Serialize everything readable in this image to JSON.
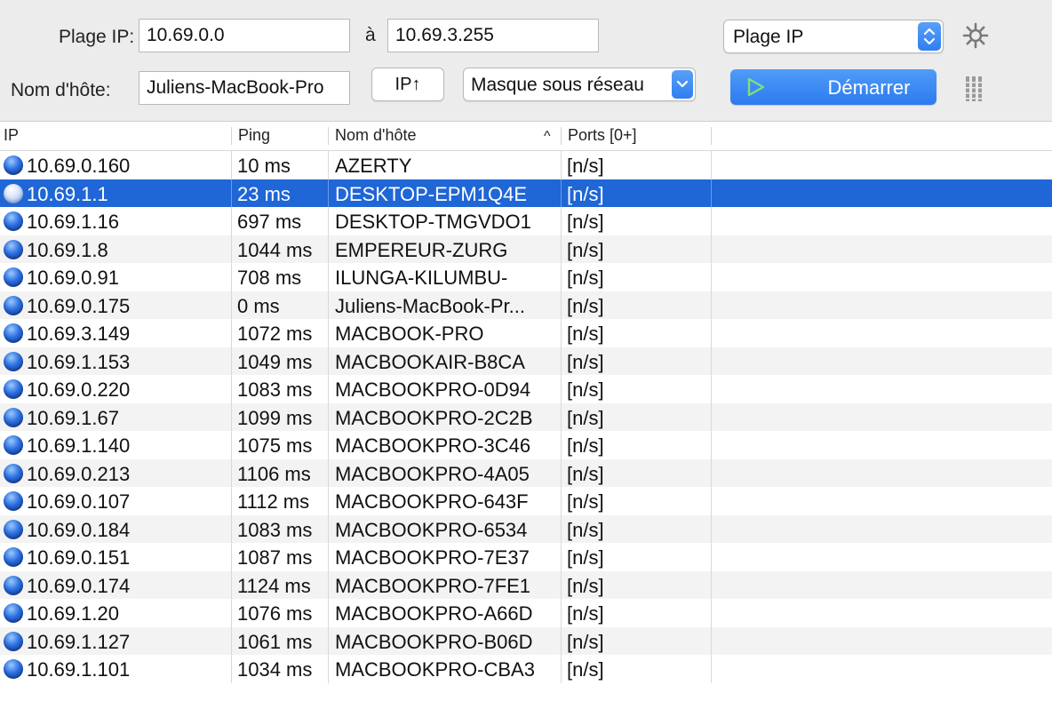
{
  "toolbar": {
    "range_label": "Plage IP:",
    "range_start": "10.69.0.0",
    "range_to": "à",
    "range_end": "10.69.3.255",
    "feeder_select": "Plage IP",
    "hostname_label": "Nom d'hôte:",
    "hostname_value": "Juliens-MacBook-Pro",
    "ip_up_button": "IP↑",
    "netmask_select": "Masque sous réseau",
    "start_button": "Démarrer"
  },
  "table": {
    "columns": [
      "IP",
      "Ping",
      "Nom d'hôte",
      "Ports [0+]"
    ],
    "sort_indicator": "^",
    "rows": [
      {
        "ip": "10.69.0.160",
        "ping": "10 ms",
        "host": "AZERTY",
        "ports": "[n/s]"
      },
      {
        "ip": "10.69.1.1",
        "ping": "23 ms",
        "host": "DESKTOP-EPM1Q4E",
        "ports": "[n/s]"
      },
      {
        "ip": "10.69.1.16",
        "ping": "697 ms",
        "host": "DESKTOP-TMGVDO1",
        "ports": "[n/s]"
      },
      {
        "ip": "10.69.1.8",
        "ping": "1044 ms",
        "host": "EMPEREUR-ZURG",
        "ports": "[n/s]"
      },
      {
        "ip": "10.69.0.91",
        "ping": "708 ms",
        "host": "ILUNGA-KILUMBU-",
        "ports": "[n/s]"
      },
      {
        "ip": "10.69.0.175",
        "ping": "0 ms",
        "host": "Juliens-MacBook-Pr...",
        "ports": "[n/s]"
      },
      {
        "ip": "10.69.3.149",
        "ping": "1072 ms",
        "host": "MACBOOK-PRO",
        "ports": "[n/s]"
      },
      {
        "ip": "10.69.1.153",
        "ping": "1049 ms",
        "host": "MACBOOKAIR-B8CA",
        "ports": "[n/s]"
      },
      {
        "ip": "10.69.0.220",
        "ping": "1083 ms",
        "host": "MACBOOKPRO-0D94",
        "ports": "[n/s]"
      },
      {
        "ip": "10.69.1.67",
        "ping": "1099 ms",
        "host": "MACBOOKPRO-2C2B",
        "ports": "[n/s]"
      },
      {
        "ip": "10.69.1.140",
        "ping": "1075 ms",
        "host": "MACBOOKPRO-3C46",
        "ports": "[n/s]"
      },
      {
        "ip": "10.69.0.213",
        "ping": "1106 ms",
        "host": "MACBOOKPRO-4A05",
        "ports": "[n/s]"
      },
      {
        "ip": "10.69.0.107",
        "ping": "1112 ms",
        "host": "MACBOOKPRO-643F",
        "ports": "[n/s]"
      },
      {
        "ip": "10.69.0.184",
        "ping": "1083 ms",
        "host": "MACBOOKPRO-6534",
        "ports": "[n/s]"
      },
      {
        "ip": "10.69.0.151",
        "ping": "1087 ms",
        "host": "MACBOOKPRO-7E37",
        "ports": "[n/s]"
      },
      {
        "ip": "10.69.0.174",
        "ping": "1124 ms",
        "host": "MACBOOKPRO-7FE1",
        "ports": "[n/s]"
      },
      {
        "ip": "10.69.1.20",
        "ping": "1076 ms",
        "host": "MACBOOKPRO-A66D",
        "ports": "[n/s]"
      },
      {
        "ip": "10.69.1.127",
        "ping": "1061 ms",
        "host": "MACBOOKPRO-B06D",
        "ports": "[n/s]"
      },
      {
        "ip": "10.69.1.101",
        "ping": "1034 ms",
        "host": "MACBOOKPRO-CBA3",
        "ports": "[n/s]"
      }
    ],
    "selected_row": 1
  },
  "colors": {
    "selection": "#1f66d6",
    "accent": "#2c7af0",
    "status_alive": "#2b6fe0"
  },
  "icons": {
    "status": "host-alive-icon",
    "settings": "gear-icon",
    "columns": "column-chooser-icon",
    "play": "play-icon"
  }
}
